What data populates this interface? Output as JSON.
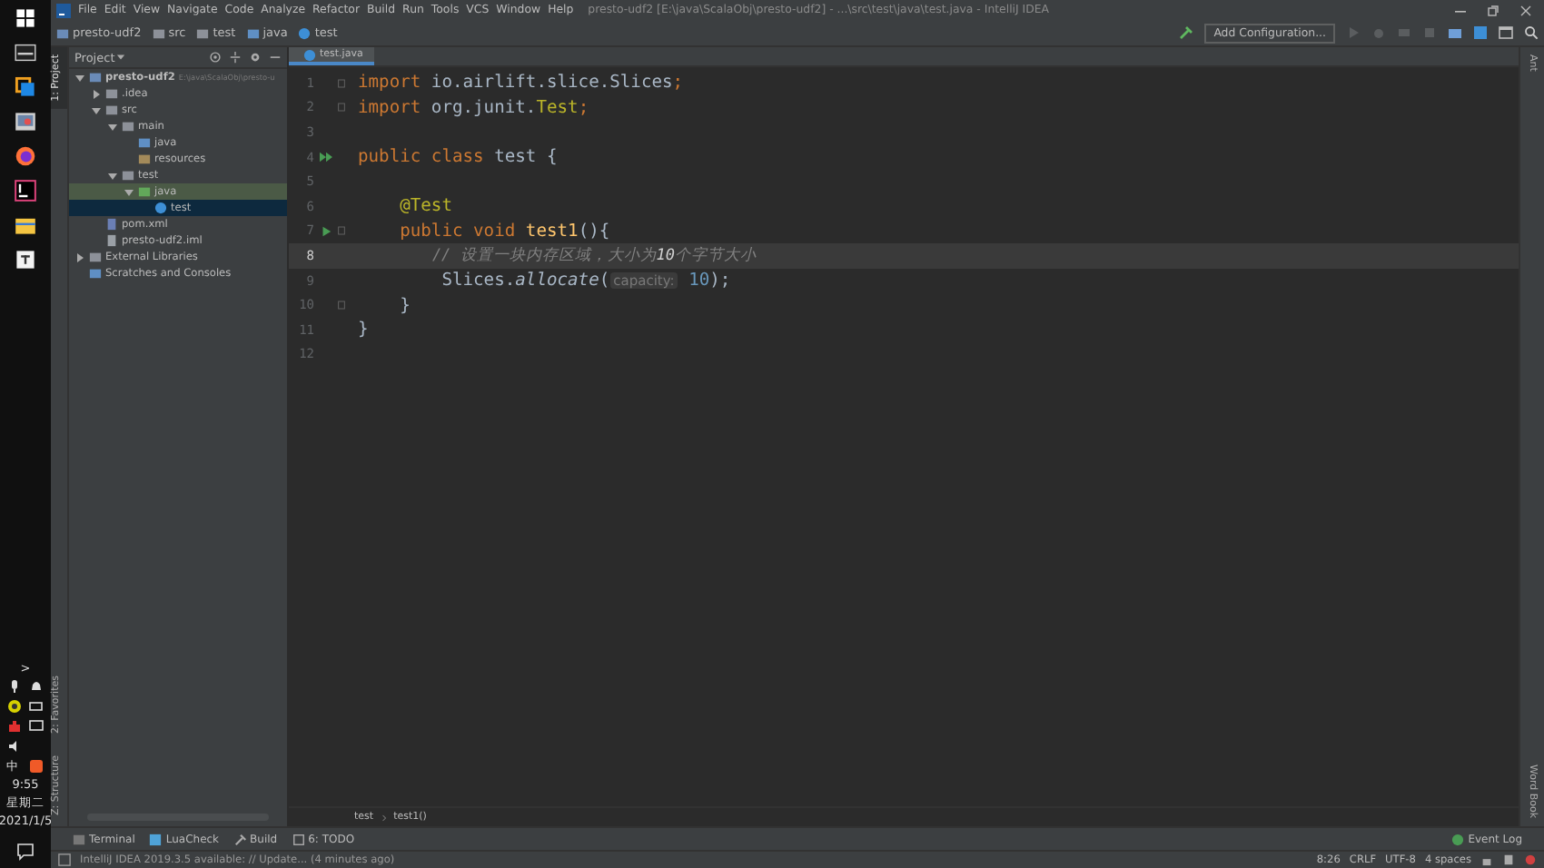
{
  "taskbar": {
    "tray": {
      "time": "9:55",
      "weekday": "星期二",
      "date": "2021/1/5",
      "ime": "中",
      "expand": ">"
    }
  },
  "menu": {
    "items": [
      "File",
      "Edit",
      "View",
      "Navigate",
      "Code",
      "Analyze",
      "Refactor",
      "Build",
      "Run",
      "Tools",
      "VCS",
      "Window",
      "Help"
    ],
    "title": "presto-udf2 [E:\\java\\ScalaObj\\presto-udf2] - ...\\src\\test\\java\\test.java - IntelliJ IDEA"
  },
  "navbar": {
    "crumbs": [
      {
        "label": "presto-udf2",
        "kind": "module"
      },
      {
        "label": "src",
        "kind": "folder"
      },
      {
        "label": "test",
        "kind": "folder"
      },
      {
        "label": "java",
        "kind": "source"
      },
      {
        "label": "test",
        "kind": "class"
      }
    ],
    "run_config": "Add Configuration..."
  },
  "left_tabs": [
    {
      "label": "1: Project",
      "selected": true
    },
    {
      "label": "2: Favorites",
      "selected": false
    },
    {
      "label": "Z: Structure",
      "selected": false
    }
  ],
  "right_tabs": [
    {
      "label": "Ant"
    },
    {
      "label": "Word Book"
    }
  ],
  "project": {
    "header": "Project",
    "tree": [
      {
        "label": "presto-udf2",
        "path": "E:\\java\\ScalaObj\\presto-u",
        "kind": "module",
        "expanded": true,
        "selected": false,
        "highlighted": false,
        "children": [
          {
            "label": ".idea",
            "kind": "folder",
            "expanded": false,
            "selected": false,
            "highlighted": false
          },
          {
            "label": "src",
            "kind": "folder",
            "expanded": true,
            "selected": false,
            "highlighted": false,
            "children": [
              {
                "label": "main",
                "kind": "folder",
                "expanded": true,
                "selected": false,
                "highlighted": false,
                "children": [
                  {
                    "label": "java",
                    "kind": "source",
                    "selected": false,
                    "highlighted": false
                  },
                  {
                    "label": "resources",
                    "kind": "resources",
                    "selected": false,
                    "highlighted": false
                  }
                ]
              },
              {
                "label": "test",
                "kind": "folder",
                "expanded": true,
                "selected": false,
                "highlighted": false,
                "children": [
                  {
                    "label": "java",
                    "kind": "testsource",
                    "expanded": true,
                    "selected": false,
                    "highlighted": true,
                    "children": [
                      {
                        "label": "test",
                        "kind": "class",
                        "selected": true,
                        "highlighted": false
                      }
                    ]
                  }
                ]
              }
            ]
          },
          {
            "label": "pom.xml",
            "kind": "maven",
            "selected": false,
            "highlighted": false
          },
          {
            "label": "presto-udf2.iml",
            "kind": "iml",
            "selected": false,
            "highlighted": false
          }
        ]
      },
      {
        "label": "External Libraries",
        "kind": "library",
        "expanded": false,
        "selected": false,
        "highlighted": false
      },
      {
        "label": "Scratches and Consoles",
        "kind": "scratch",
        "selected": false,
        "highlighted": false
      }
    ]
  },
  "editor": {
    "tab": "test.java",
    "lines": [
      {
        "number": "1",
        "kind": "fold",
        "current": false,
        "tokens": [
          {
            "kind": "keyword",
            "text": "import"
          },
          {
            "kind": "plain",
            "text": " io.airlift.slice.Slices"
          },
          {
            "kind": "keyword",
            "text": ";"
          }
        ]
      },
      {
        "number": "2",
        "kind": "fold",
        "current": false,
        "tokens": [
          {
            "kind": "keyword",
            "text": "import"
          },
          {
            "kind": "plain",
            "text": " org.junit."
          },
          {
            "kind": "type",
            "text": "Test"
          },
          {
            "kind": "keyword",
            "text": ";"
          }
        ]
      },
      {
        "number": "3",
        "kind": "plain",
        "current": false
      },
      {
        "number": "4",
        "kind": "run-class",
        "current": false,
        "tokens": [
          {
            "kind": "keyword",
            "text": "public class "
          },
          {
            "kind": "plain",
            "text": "test {"
          }
        ]
      },
      {
        "number": "5",
        "kind": "plain",
        "current": false
      },
      {
        "number": "6",
        "kind": "plain",
        "current": false,
        "tokens": [
          {
            "kind": "annotation",
            "text": "    @Test"
          }
        ]
      },
      {
        "number": "7",
        "kind": "run-method",
        "current": false,
        "tokens": [
          {
            "kind": "keyword",
            "text": "    public void "
          },
          {
            "kind": "method",
            "text": "test1"
          },
          {
            "kind": "plain",
            "text": "(){"
          }
        ]
      },
      {
        "number": "8",
        "kind": "plain",
        "current": true,
        "tokens": [
          {
            "kind": "comment",
            "text": "        // 设置一块内存区域，大小为"
          },
          {
            "kind": "match",
            "text": "10"
          },
          {
            "kind": "comment",
            "text": "个字节大小"
          }
        ]
      },
      {
        "number": "9",
        "kind": "plain",
        "current": false,
        "tokens": [
          {
            "kind": "plain",
            "text": "        Slices."
          },
          {
            "kind": "static",
            "text": "allocate"
          },
          {
            "kind": "plain",
            "text": "("
          },
          {
            "kind": "hint",
            "text": "capacity:"
          },
          {
            "kind": "number",
            "text": " 10"
          },
          {
            "kind": "plain",
            "text": ");"
          }
        ]
      },
      {
        "number": "10",
        "kind": "fold",
        "current": false,
        "tokens": [
          {
            "kind": "plain",
            "text": "    }"
          }
        ]
      },
      {
        "number": "11",
        "kind": "plain",
        "current": false,
        "tokens": [
          {
            "kind": "plain",
            "text": "}"
          }
        ]
      },
      {
        "number": "12",
        "kind": "plain",
        "current": false
      }
    ],
    "breadcrumbs": [
      "test",
      "test1()"
    ]
  },
  "tool_tabs": [
    {
      "label": "Terminal",
      "kind": "terminal"
    },
    {
      "label": "LuaCheck",
      "kind": "lua"
    },
    {
      "label": "Build",
      "kind": "build"
    },
    {
      "label": "6: TODO",
      "kind": "todo"
    }
  ],
  "event_log": "Event Log",
  "status": {
    "message": "IntelliJ IDEA 2019.3.5 available: // Update... (4 minutes ago)",
    "position": "8:26",
    "line_sep": "CRLF",
    "encoding": "UTF-8",
    "indent": "4 spaces"
  }
}
